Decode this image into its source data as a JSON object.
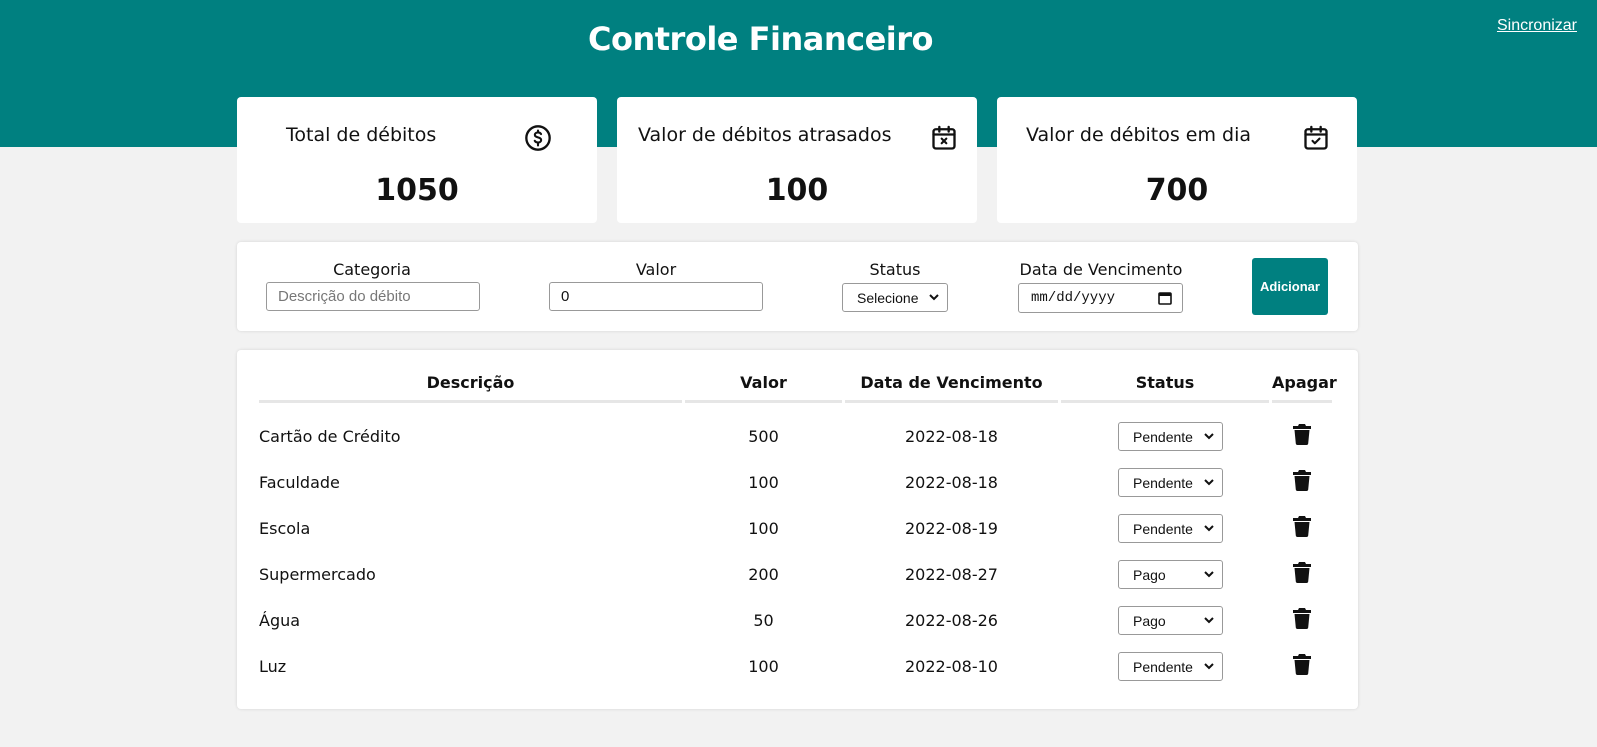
{
  "header": {
    "title": "Controle Financeiro",
    "sync_label": "Sincronizar",
    "color": "#008080"
  },
  "cards": [
    {
      "title": "Total de débitos",
      "value": "1050",
      "icon": "dollar-circle-icon"
    },
    {
      "title": "Valor de débitos atrasados",
      "value": "100",
      "icon": "calendar-x-icon"
    },
    {
      "title": "Valor de débitos em dia",
      "value": "700",
      "icon": "calendar-check-icon"
    }
  ],
  "form": {
    "categoria_label": "Categoria",
    "categoria_placeholder": "Descrição do débito",
    "valor_label": "Valor",
    "valor_value": "0",
    "status_label": "Status",
    "status_value": "Selecione",
    "vencimento_label": "Data de Vencimento",
    "vencimento_placeholder": "mm/dd/yyyy",
    "add_label": "Adicionar"
  },
  "table": {
    "headers": {
      "descricao": "Descrição",
      "valor": "Valor",
      "vencimento": "Data de Vencimento",
      "status": "Status",
      "apagar": "Apagar"
    },
    "rows": [
      {
        "descricao": "Cartão de Crédito",
        "valor": "500",
        "vencimento": "2022-08-18",
        "status": "Pendente"
      },
      {
        "descricao": "Faculdade",
        "valor": "100",
        "vencimento": "2022-08-18",
        "status": "Pendente"
      },
      {
        "descricao": "Escola",
        "valor": "100",
        "vencimento": "2022-08-19",
        "status": "Pendente"
      },
      {
        "descricao": "Supermercado",
        "valor": "200",
        "vencimento": "2022-08-27",
        "status": "Pago"
      },
      {
        "descricao": "Água",
        "valor": "50",
        "vencimento": "2022-08-26",
        "status": "Pago"
      },
      {
        "descricao": "Luz",
        "valor": "100",
        "vencimento": "2022-08-10",
        "status": "Pendente"
      }
    ]
  }
}
